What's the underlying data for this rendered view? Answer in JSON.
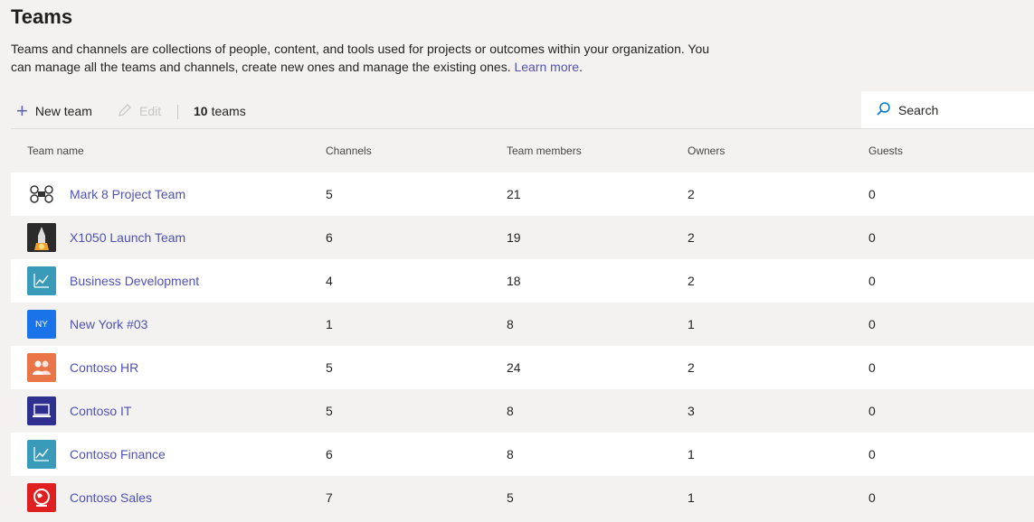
{
  "page": {
    "title": "Teams",
    "description": "Teams and channels are collections of people, content, and tools used for projects or outcomes within your organization. You can manage all the teams and channels, create new ones and manage the existing ones.",
    "learn_more": "Learn more",
    "description_end": "."
  },
  "toolbar": {
    "new_team": "New team",
    "edit": "Edit",
    "count_number": "10",
    "count_label": "teams",
    "search_placeholder": "Search"
  },
  "table": {
    "headers": {
      "team_name": "Team name",
      "channels": "Channels",
      "members": "Team members",
      "owners": "Owners",
      "guests": "Guests"
    },
    "rows": [
      {
        "name": "Mark 8 Project Team",
        "channels": "5",
        "members": "21",
        "owners": "2",
        "guests": "0",
        "icon": "drone-icon",
        "icon_bg": "#ffffff"
      },
      {
        "name": "X1050 Launch Team",
        "channels": "6",
        "members": "19",
        "owners": "2",
        "guests": "0",
        "icon": "rocket-icon",
        "icon_bg": "#2b2b2b"
      },
      {
        "name": "Business Development",
        "channels": "4",
        "members": "18",
        "owners": "2",
        "guests": "0",
        "icon": "chart-icon",
        "icon_bg": "#3a9bb8"
      },
      {
        "name": "New York #03",
        "channels": "1",
        "members": "8",
        "owners": "1",
        "guests": "0",
        "icon": "ny-initials-icon",
        "icon_bg": "#1a73e8",
        "initials": "NY"
      },
      {
        "name": "Contoso HR",
        "channels": "5",
        "members": "24",
        "owners": "2",
        "guests": "0",
        "icon": "people-icon",
        "icon_bg": "#e97548"
      },
      {
        "name": "Contoso IT",
        "channels": "5",
        "members": "8",
        "owners": "3",
        "guests": "0",
        "icon": "laptop-icon",
        "icon_bg": "#2f2f8f"
      },
      {
        "name": "Contoso Finance",
        "channels": "6",
        "members": "8",
        "owners": "1",
        "guests": "0",
        "icon": "chart-icon",
        "icon_bg": "#3a9bb8"
      },
      {
        "name": "Contoso Sales",
        "channels": "7",
        "members": "5",
        "owners": "1",
        "guests": "0",
        "icon": "globe-icon",
        "icon_bg": "#e02020"
      }
    ]
  },
  "colors": {
    "accent": "#6264a7",
    "link": "#4f52b2",
    "background": "#f3f2f1"
  }
}
